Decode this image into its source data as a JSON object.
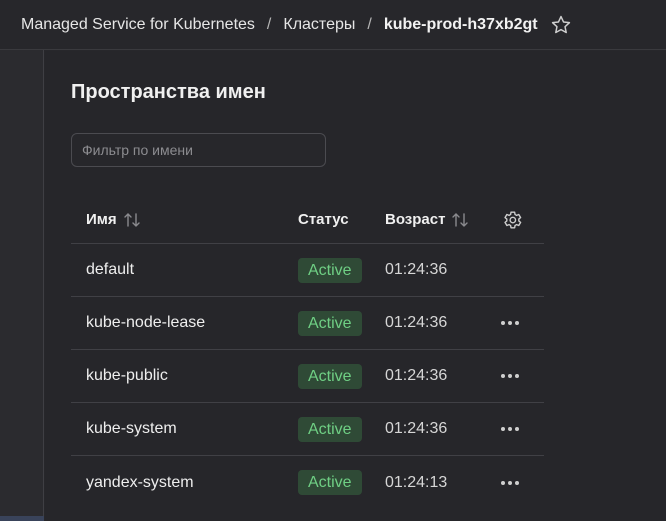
{
  "breadcrumbs": [
    "Managed Service for Kubernetes",
    "Кластеры",
    "kube-prod-h37xb2gt"
  ],
  "breadcrumb_separator": "/",
  "page_title": "Пространства имен",
  "filter": {
    "placeholder": "Фильтр по имени",
    "value": ""
  },
  "table": {
    "columns": {
      "name": "Имя",
      "status": "Статус",
      "age": "Возраст"
    },
    "rows": [
      {
        "name": "default",
        "status": "Active",
        "age": "01:24:36",
        "has_actions": false
      },
      {
        "name": "kube-node-lease",
        "status": "Active",
        "age": "01:24:36",
        "has_actions": true
      },
      {
        "name": "kube-public",
        "status": "Active",
        "age": "01:24:36",
        "has_actions": true
      },
      {
        "name": "kube-system",
        "status": "Active",
        "age": "01:24:36",
        "has_actions": true
      },
      {
        "name": "yandex-system",
        "status": "Active",
        "age": "01:24:13",
        "has_actions": true
      }
    ]
  },
  "icons": {
    "favorite": "star-icon",
    "sort": "sort-arrows-icon",
    "settings": "gear-icon",
    "row_actions": "more-horizontal-icon"
  },
  "colors": {
    "background": "#27272b",
    "status_active_bg": "#2f4a36",
    "status_active_text": "#6fcf84"
  }
}
